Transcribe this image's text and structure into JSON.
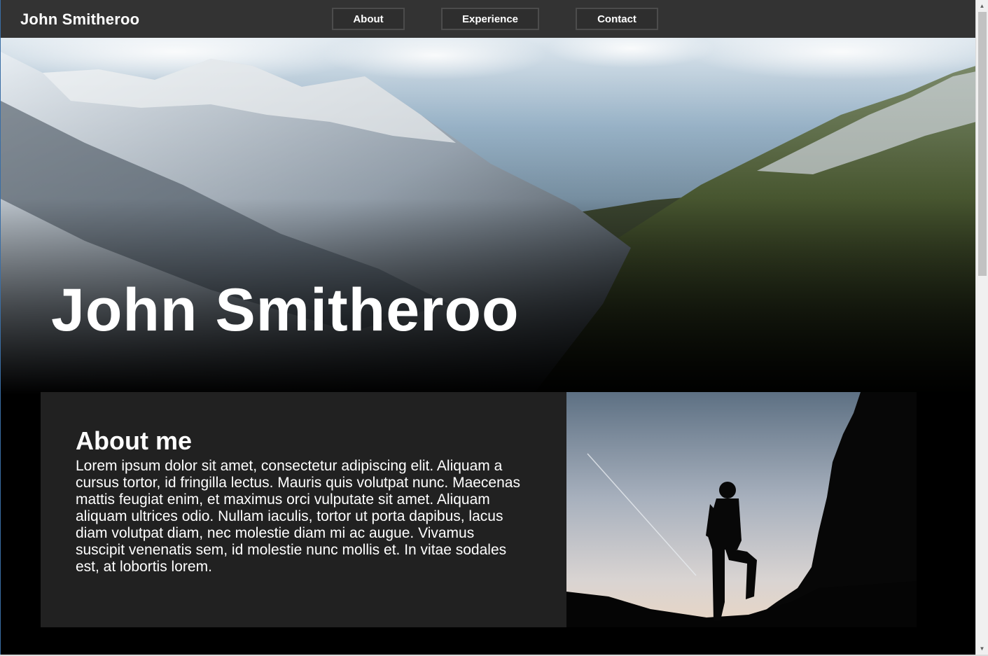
{
  "navbar": {
    "brand": "John Smitheroo",
    "links": [
      "About",
      "Experience",
      "Contact"
    ]
  },
  "hero": {
    "title": "John Smitheroo"
  },
  "about": {
    "heading": "About me",
    "body": "Lorem ipsum dolor sit amet, consectetur adipiscing elit. Aliquam a cursus tortor, id fringilla lectus. Mauris quis volutpat nunc. Maecenas mattis feugiat enim, et maximus orci vulputate sit amet. Aliquam aliquam ultrices odio. Nullam iaculis, tortor ut porta dapibus, lacus diam volutpat diam, nec molestie diam mi ac augue. Vivamus suscipit venenatis sem, id molestie nunc mollis et. In vitae sodales est, at lobortis lorem."
  },
  "colors": {
    "navbar_bg": "#333333",
    "page_bg": "#000000",
    "about_panel_bg": "#212121"
  },
  "icons": {
    "scroll_up": "scroll-up-arrow-icon",
    "scroll_down": "scroll-down-arrow-icon"
  }
}
